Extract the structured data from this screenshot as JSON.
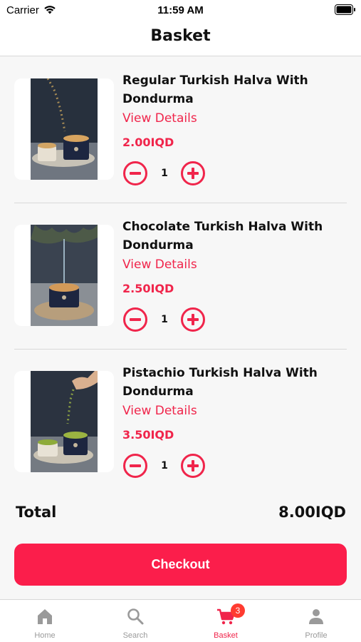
{
  "status_bar": {
    "carrier": "Carrier",
    "time": "11:59 AM"
  },
  "nav": {
    "title": "Basket"
  },
  "items": [
    {
      "name": "Regular Turkish Halva With Dondurma",
      "link": "View Details",
      "price": "2.00IQD",
      "quantity": "1",
      "thumb_icon": "halva-cup-photo"
    },
    {
      "name": "Chocolate Turkish Halva With Dondurma",
      "link": "View Details",
      "price": "2.50IQD",
      "quantity": "1",
      "thumb_icon": "halva-cup-photo"
    },
    {
      "name": "Pistachio Turkish Halva With Dondurma",
      "link": "View Details",
      "price": "3.50IQD",
      "quantity": "1",
      "thumb_icon": "halva-cup-photo"
    }
  ],
  "total": {
    "label": "Total",
    "value": "8.00IQD"
  },
  "checkout": {
    "label": "Checkout"
  },
  "tabs": [
    {
      "label": "Home",
      "icon": "home-icon"
    },
    {
      "label": "Search",
      "icon": "search-icon"
    },
    {
      "label": "Basket",
      "icon": "cart-icon",
      "badge": "3",
      "active": true
    },
    {
      "label": "Profile",
      "icon": "person-icon"
    }
  ],
  "colors": {
    "accent": "#f0254b",
    "checkout_bg": "#fb1e4b",
    "badge": "#ff3b30",
    "inactive_tab": "#9a9a9a"
  }
}
